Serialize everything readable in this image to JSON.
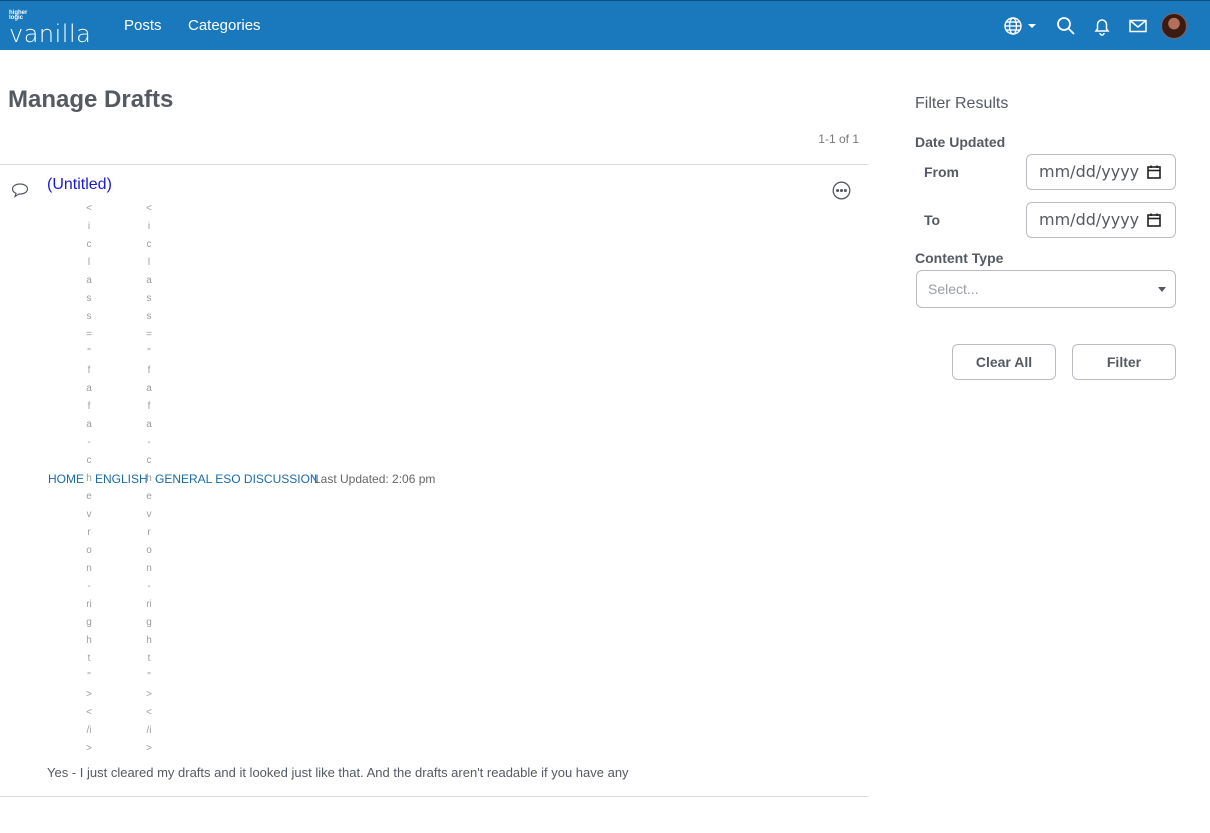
{
  "header": {
    "logo_small": "higher logic",
    "logo_big": "vanilla",
    "nav": [
      "Posts",
      "Categories"
    ]
  },
  "main": {
    "title": "Manage Drafts",
    "pager": "1-1 of 1",
    "draft": {
      "title": "(Untitled)",
      "breadcrumbs": [
        "HOME",
        "ENGLISH",
        "GENERAL ESO DISCUSSION"
      ],
      "breadcrumb_glitch_chars": [
        "<",
        "i",
        "c",
        "l",
        "a",
        "s",
        "s",
        "=",
        "\"",
        "f",
        "a",
        "f",
        "a",
        "-",
        "c",
        "h",
        "e",
        "v",
        "r",
        "o",
        "n",
        "-",
        "ri",
        "g",
        "h",
        "t",
        "\"",
        ">",
        "<",
        "/i",
        ">"
      ],
      "updated": "Last Updated: 2:06 pm",
      "excerpt": "Yes - I just cleared my drafts and it looked just like that. And the drafts aren't readable if you have any"
    }
  },
  "filter": {
    "title": "Filter Results",
    "date_label": "Date Updated",
    "from_label": "From",
    "to_label": "To",
    "date_placeholder": "mm/dd/yyyy",
    "content_type_label": "Content Type",
    "select_placeholder": "Select...",
    "clear_label": "Clear All",
    "filter_label": "Filter"
  },
  "colors": {
    "header_bg": "#1a78bd",
    "title_link": "#1a1ad6",
    "breadcrumb_link": "#1a6aa8"
  }
}
